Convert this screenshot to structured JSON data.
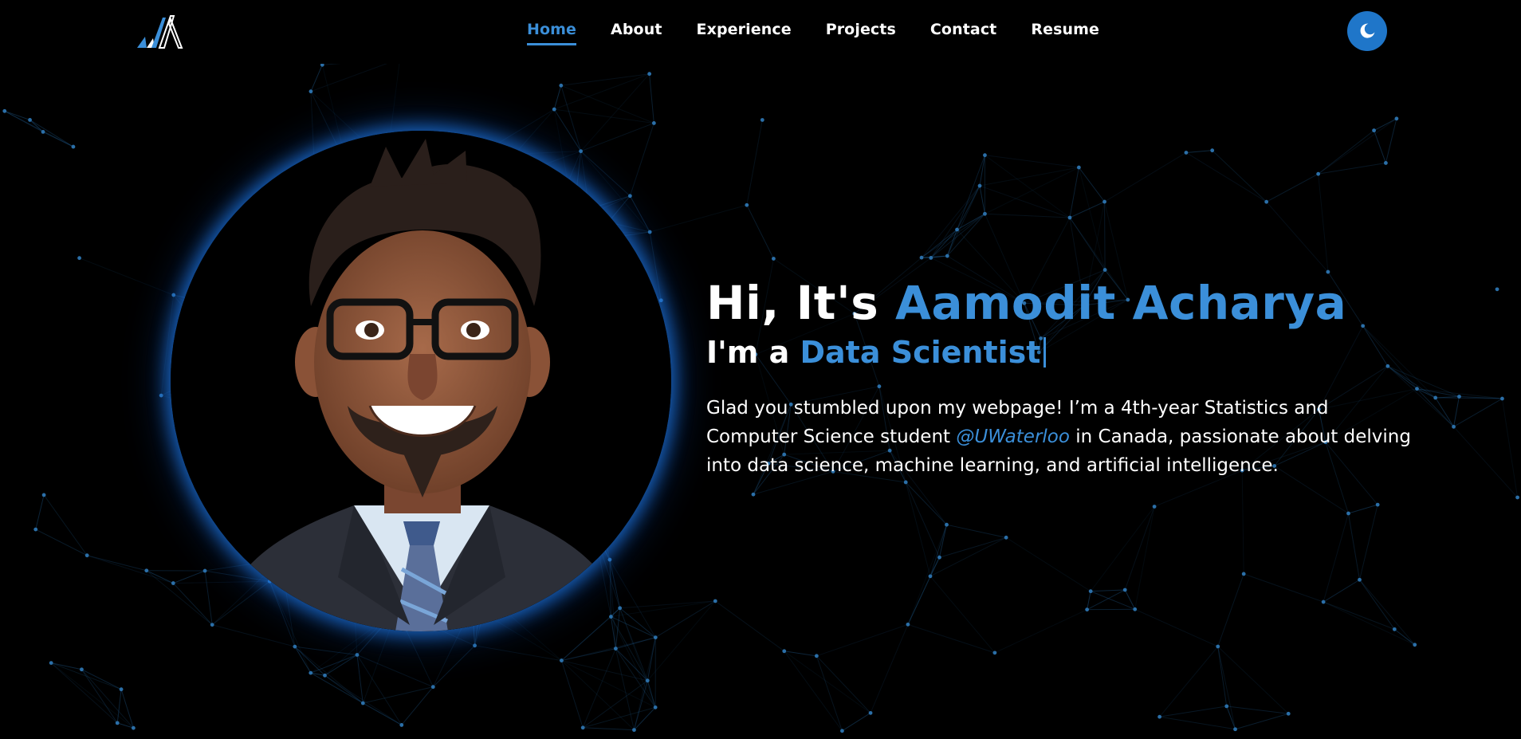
{
  "logo": {
    "icon": "stylized-mountain-peaks-icon",
    "accent": "#3b8fd9"
  },
  "nav": {
    "items": [
      {
        "label": "Home",
        "active": true
      },
      {
        "label": "About",
        "active": false
      },
      {
        "label": "Experience",
        "active": false
      },
      {
        "label": "Projects",
        "active": false
      },
      {
        "label": "Contact",
        "active": false
      },
      {
        "label": "Resume",
        "active": false
      }
    ]
  },
  "theme_toggle": {
    "icon": "moon-icon",
    "color": "#1f76c9"
  },
  "hero": {
    "greeting": "Hi, It's ",
    "name": "Aamodit Acharya",
    "role_prefix": "I'm a ",
    "role": "Data Scientist",
    "desc_before": "Glad you stumbled upon my webpage! I’m a 4th-year Statistics and Computer Science student ",
    "desc_link": "@UWaterloo",
    "desc_after": " in Canada, passionate about delving into data science, machine learning, and artificial intelligence."
  },
  "colors": {
    "accent": "#3b8fd9",
    "background": "#000000",
    "glow": "#1e78e6"
  }
}
